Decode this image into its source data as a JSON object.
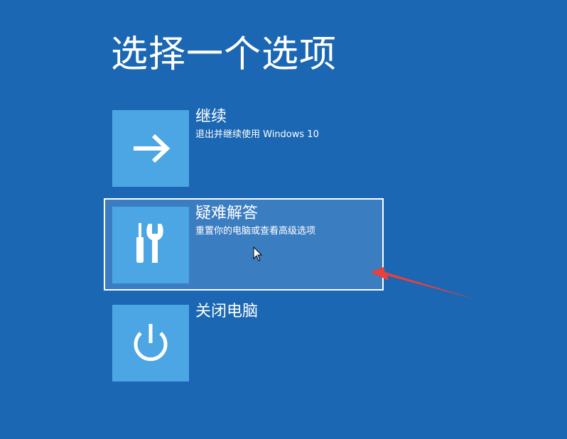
{
  "page": {
    "title": "选择一个选项"
  },
  "options": [
    {
      "title": "继续",
      "subtitle": "退出并继续使用 Windows 10",
      "icon": "arrow-right-icon"
    },
    {
      "title": "疑难解答",
      "subtitle": "重置你的电脑或查看高级选项",
      "icon": "tools-icon",
      "selected": true
    },
    {
      "title": "关闭电脑",
      "subtitle": "",
      "icon": "power-icon"
    }
  ],
  "colors": {
    "background": "#1b67b3",
    "tile": "#4ba6e3",
    "selected_background": "#3b7dc1",
    "annotation_arrow": "#e8403a"
  }
}
